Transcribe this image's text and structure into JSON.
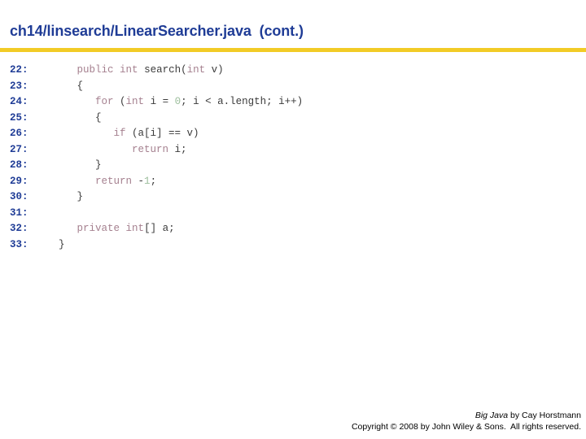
{
  "slide": {
    "title": "ch14/linsearch/LinearSearcher.java  (cont.)",
    "accent_color": "#F2CB26",
    "title_color": "#1F3C96"
  },
  "code": {
    "keyword_color": "#A5808F",
    "number_color": "#9CBE9C",
    "plain_color": "#3B3B3B",
    "linenumber_color": "#1F3C96",
    "lines": [
      {
        "number": "22:",
        "text": "   public int search(int v)",
        "tokens": [
          {
            "t": "   ",
            "c": "plain"
          },
          {
            "t": "public",
            "c": "kw"
          },
          {
            "t": " ",
            "c": "plain"
          },
          {
            "t": "int",
            "c": "kw"
          },
          {
            "t": " search(",
            "c": "plain"
          },
          {
            "t": "int",
            "c": "kw"
          },
          {
            "t": " v)",
            "c": "plain"
          }
        ]
      },
      {
        "number": "23:",
        "text": "   {",
        "tokens": [
          {
            "t": "   {",
            "c": "plain"
          }
        ]
      },
      {
        "number": "24:",
        "text": "      for (int i = 0; i < a.length; i++)",
        "tokens": [
          {
            "t": "      ",
            "c": "plain"
          },
          {
            "t": "for",
            "c": "kw"
          },
          {
            "t": " (",
            "c": "plain"
          },
          {
            "t": "int",
            "c": "kw"
          },
          {
            "t": " i = ",
            "c": "plain"
          },
          {
            "t": "0",
            "c": "num"
          },
          {
            "t": "; i < a.length; i++)",
            "c": "plain"
          }
        ]
      },
      {
        "number": "25:",
        "text": "      {",
        "tokens": [
          {
            "t": "      {",
            "c": "plain"
          }
        ]
      },
      {
        "number": "26:",
        "text": "         if (a[i] == v)",
        "tokens": [
          {
            "t": "         ",
            "c": "plain"
          },
          {
            "t": "if",
            "c": "kw"
          },
          {
            "t": " (a[i] == v)",
            "c": "plain"
          }
        ]
      },
      {
        "number": "27:",
        "text": "            return i;",
        "tokens": [
          {
            "t": "            ",
            "c": "plain"
          },
          {
            "t": "return",
            "c": "kw"
          },
          {
            "t": " i;",
            "c": "plain"
          }
        ]
      },
      {
        "number": "28:",
        "text": "      }",
        "tokens": [
          {
            "t": "      }",
            "c": "plain"
          }
        ]
      },
      {
        "number": "29:",
        "text": "      return -1;",
        "tokens": [
          {
            "t": "      ",
            "c": "plain"
          },
          {
            "t": "return",
            "c": "kw"
          },
          {
            "t": " -",
            "c": "plain"
          },
          {
            "t": "1",
            "c": "num"
          },
          {
            "t": ";",
            "c": "plain"
          }
        ]
      },
      {
        "number": "30:",
        "text": "   }",
        "tokens": [
          {
            "t": "   }",
            "c": "plain"
          }
        ]
      },
      {
        "number": "31:",
        "text": "",
        "tokens": []
      },
      {
        "number": "32:",
        "text": "   private int[] a;",
        "tokens": [
          {
            "t": "   ",
            "c": "plain"
          },
          {
            "t": "private",
            "c": "kw"
          },
          {
            "t": " ",
            "c": "plain"
          },
          {
            "t": "int",
            "c": "kw"
          },
          {
            "t": "[] a;",
            "c": "plain"
          }
        ]
      },
      {
        "number": "33:",
        "text": "}",
        "tokens": [
          {
            "t": "}",
            "c": "plain"
          }
        ]
      }
    ]
  },
  "footer": {
    "book_title": "Big Java",
    "attribution": " by Cay Horstmann",
    "copyright": "Copyright © 2008 by John Wiley & Sons.  All rights reserved."
  }
}
